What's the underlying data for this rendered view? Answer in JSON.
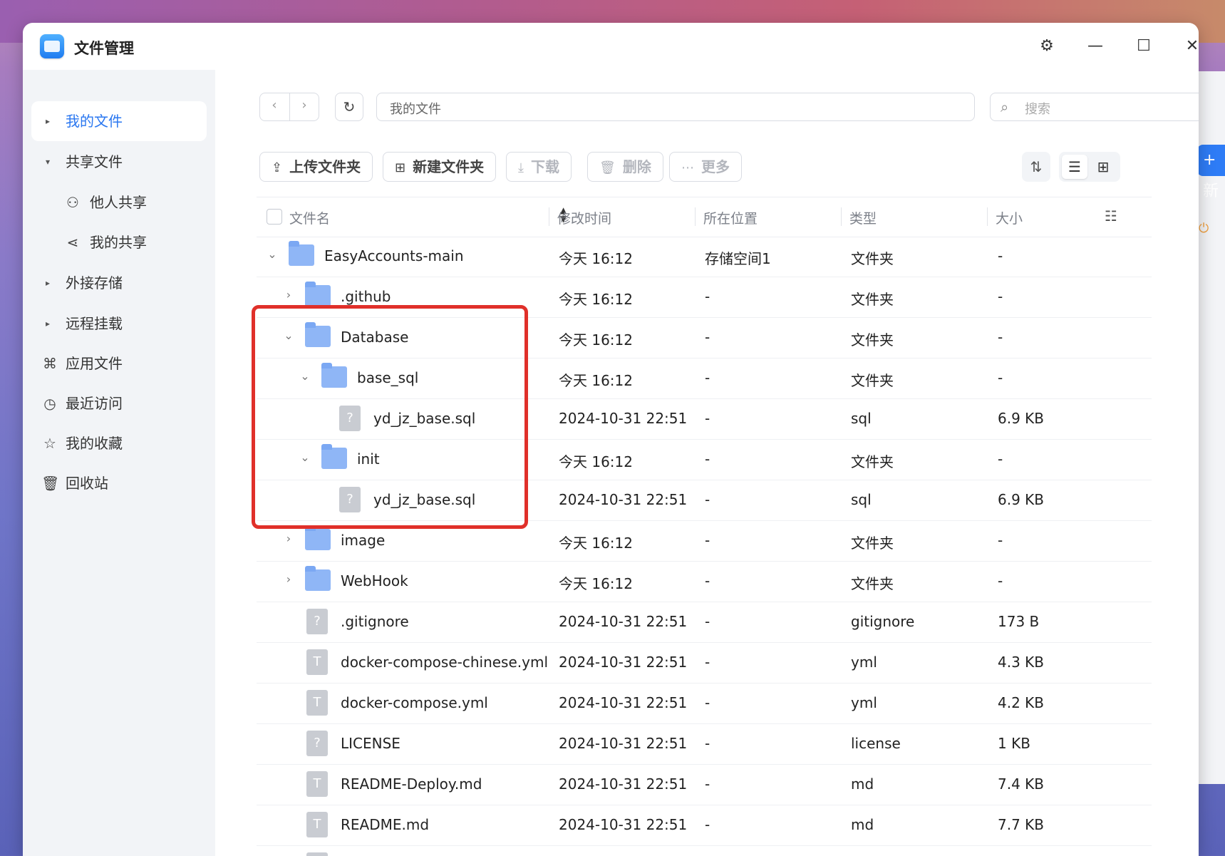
{
  "window": {
    "title": "文件管理"
  },
  "sidebar": {
    "my_files": "我的文件",
    "shared_files": "共享文件",
    "others_share": "他人共享",
    "my_share": "我的共享",
    "external_storage": "外接存储",
    "remote_mount": "远程挂载",
    "app_files": "应用文件",
    "recent": "最近访问",
    "favorites": "我的收藏",
    "recycle_bin": "回收站"
  },
  "toolbar": {
    "path": "我的文件",
    "search_placeholder": "搜索",
    "upload_folder": "上传文件夹",
    "new_folder": "新建文件夹",
    "download": "下载",
    "delete": "删除",
    "more": "更多"
  },
  "columns": {
    "name": "文件名",
    "modified": "修改时间",
    "location": "所在位置",
    "type": "类型",
    "size": "大小"
  },
  "rows": [
    {
      "name": "EasyAccounts-main",
      "modified": "今天 16:12",
      "location": "存储空间1",
      "type": "文件夹",
      "size": "-"
    },
    {
      "name": ".github",
      "modified": "今天 16:12",
      "location": "-",
      "type": "文件夹",
      "size": "-"
    },
    {
      "name": "Database",
      "modified": "今天 16:12",
      "location": "-",
      "type": "文件夹",
      "size": "-"
    },
    {
      "name": "base_sql",
      "modified": "今天 16:12",
      "location": "-",
      "type": "文件夹",
      "size": "-"
    },
    {
      "name": "yd_jz_base.sql",
      "modified": "2024-10-31 22:51",
      "location": "-",
      "type": "sql",
      "size": "6.9 KB"
    },
    {
      "name": "init",
      "modified": "今天 16:12",
      "location": "-",
      "type": "文件夹",
      "size": "-"
    },
    {
      "name": "yd_jz_base.sql",
      "modified": "2024-10-31 22:51",
      "location": "-",
      "type": "sql",
      "size": "6.9 KB"
    },
    {
      "name": "image",
      "modified": "今天 16:12",
      "location": "-",
      "type": "文件夹",
      "size": "-"
    },
    {
      "name": "WebHook",
      "modified": "今天 16:12",
      "location": "-",
      "type": "文件夹",
      "size": "-"
    },
    {
      "name": ".gitignore",
      "modified": "2024-10-31 22:51",
      "location": "-",
      "type": "gitignore",
      "size": "173 B"
    },
    {
      "name": "docker-compose-chinese.yml",
      "modified": "2024-10-31 22:51",
      "location": "-",
      "type": "yml",
      "size": "4.3 KB"
    },
    {
      "name": "docker-compose.yml",
      "modified": "2024-10-31 22:51",
      "location": "-",
      "type": "yml",
      "size": "4.2 KB"
    },
    {
      "name": "LICENSE",
      "modified": "2024-10-31 22:51",
      "location": "-",
      "type": "license",
      "size": "1 KB"
    },
    {
      "name": "README-Deploy.md",
      "modified": "2024-10-31 22:51",
      "location": "-",
      "type": "md",
      "size": "7.4 KB"
    },
    {
      "name": "README.md",
      "modified": "2024-10-31 22:51",
      "location": "-",
      "type": "md",
      "size": "7.7 KB"
    }
  ],
  "colors": {
    "accent": "#2a77f0",
    "highlight": "#e0302a",
    "folder": "#8fb6f6"
  },
  "peek": {
    "new_label": "+ 新"
  }
}
